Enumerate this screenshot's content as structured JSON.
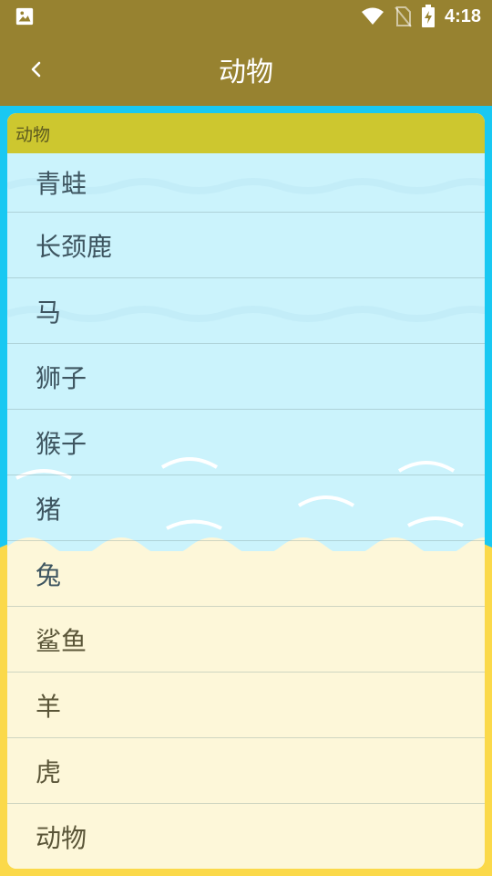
{
  "status_bar": {
    "time": "4:18",
    "left_icon": "image-icon",
    "right_icons": [
      "wifi-icon",
      "no-sim-icon",
      "battery-charging-icon"
    ]
  },
  "app_bar": {
    "title": "动物",
    "back_icon": "chevron-left-icon"
  },
  "list": {
    "section_header": "动物",
    "items": [
      {
        "label": "青蛙"
      },
      {
        "label": "长颈鹿"
      },
      {
        "label": "马"
      },
      {
        "label": "狮子"
      },
      {
        "label": "猴子"
      },
      {
        "label": "猪"
      },
      {
        "label": "兔"
      },
      {
        "label": "鲨鱼"
      },
      {
        "label": "羊"
      },
      {
        "label": "虎"
      },
      {
        "label": "动物"
      }
    ]
  },
  "colors": {
    "app_bar": "#978230",
    "section_header": "#cdc72f",
    "sky": "#19c8f2",
    "sand": "#fbd94a"
  }
}
